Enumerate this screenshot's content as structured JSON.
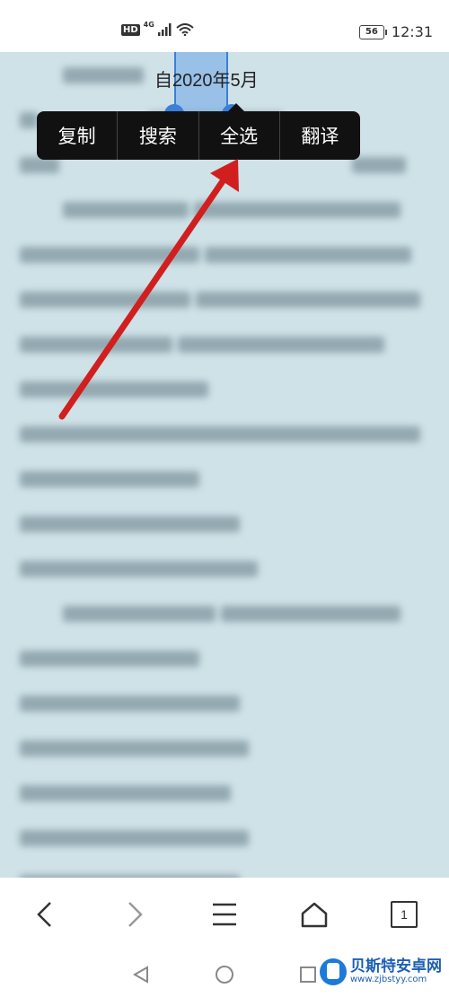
{
  "status_bar": {
    "hd": "HD",
    "network": "4G",
    "battery": "56",
    "time": "12:31"
  },
  "selection": {
    "text": "自2020年5月"
  },
  "context_menu": {
    "items": [
      "复制",
      "搜索",
      "全选",
      "翻译"
    ]
  },
  "toolbar": {
    "icons": [
      "back-icon",
      "forward-icon",
      "menu-icon",
      "home-icon",
      "tabs-icon"
    ],
    "tab_count": "1"
  },
  "system_nav": {
    "icons": [
      "nav-back-icon",
      "nav-home-icon",
      "nav-recents-icon"
    ]
  },
  "watermark": {
    "title": "贝斯特安卓网",
    "url": "www.zjbstyy.com"
  },
  "colors": {
    "page_background": "#cfe2e8",
    "menu_background": "#111111",
    "arrow": "#d11f1f",
    "selection": "#3b7fd6"
  }
}
